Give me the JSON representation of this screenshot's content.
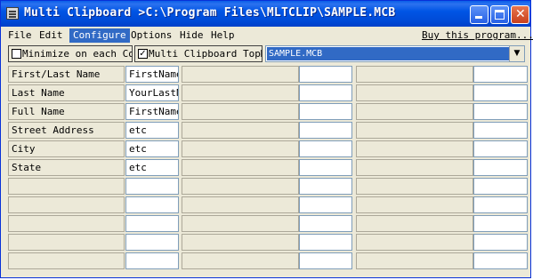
{
  "window": {
    "title": "Multi Clipboard >C:\\Program Files\\MLTCLIP\\SAMPLE.MCB"
  },
  "menu": [
    {
      "label": "File"
    },
    {
      "label": "Edit"
    },
    {
      "label": "Configure"
    },
    {
      "label": "Options"
    },
    {
      "label": "Hide"
    },
    {
      "label": "Help"
    },
    {
      "label": "Buy this program..."
    }
  ],
  "toolbar": {
    "minimize_label": "Minimize on each Copy",
    "minimize_checked": false,
    "topmost_label": "Multi Clipboard TopMost",
    "topmost_checked": true,
    "file_selected": "SAMPLE.MCB"
  },
  "grid": {
    "rows": [
      {
        "label": "First/Last Name",
        "value": "FirstName"
      },
      {
        "label": "Last Name",
        "value": "YourLastName"
      },
      {
        "label": "Full Name",
        "value": "FirstName"
      },
      {
        "label": "Street Address",
        "value": "etc"
      },
      {
        "label": "City",
        "value": "etc"
      },
      {
        "label": "State",
        "value": "etc"
      },
      {
        "label": "",
        "value": ""
      },
      {
        "label": "",
        "value": ""
      },
      {
        "label": "",
        "value": ""
      },
      {
        "label": "",
        "value": ""
      },
      {
        "label": "",
        "value": ""
      }
    ]
  }
}
